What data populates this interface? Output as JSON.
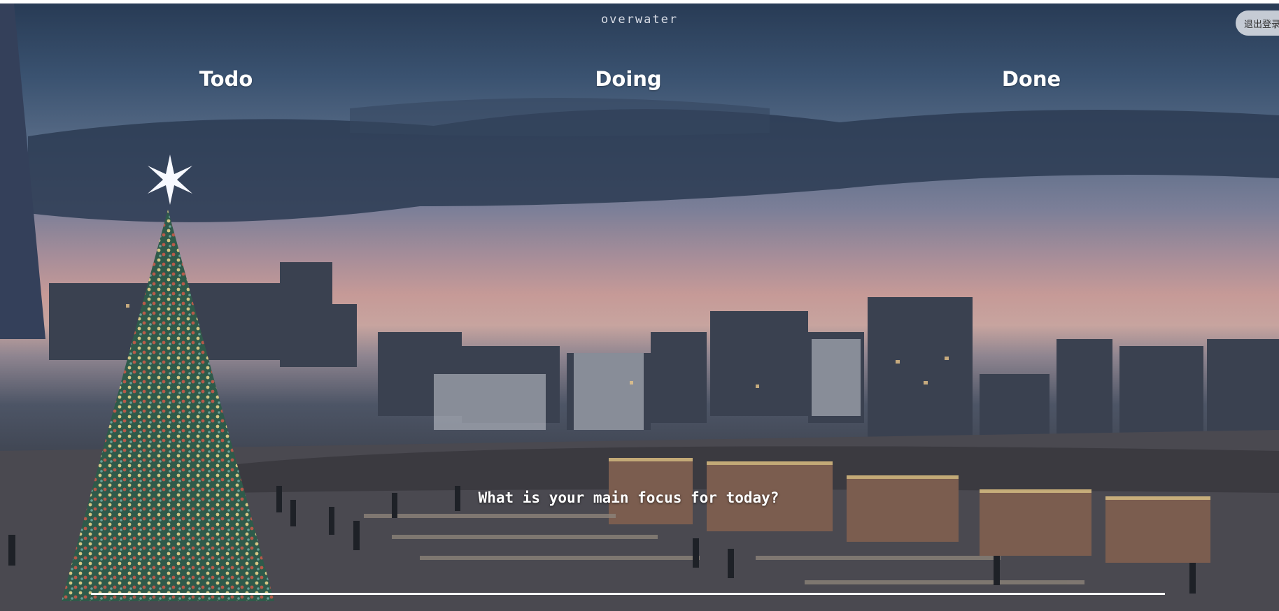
{
  "app": {
    "title": "overwater"
  },
  "header": {
    "logout_label": "退出登录"
  },
  "board": {
    "columns": [
      {
        "label": "Todo"
      },
      {
        "label": "Doing"
      },
      {
        "label": "Done"
      }
    ]
  },
  "focus": {
    "question": "What is your main focus for today?",
    "value": ""
  },
  "colors": {
    "text": "#ffffff",
    "button_bg": "#e1e4ea"
  }
}
